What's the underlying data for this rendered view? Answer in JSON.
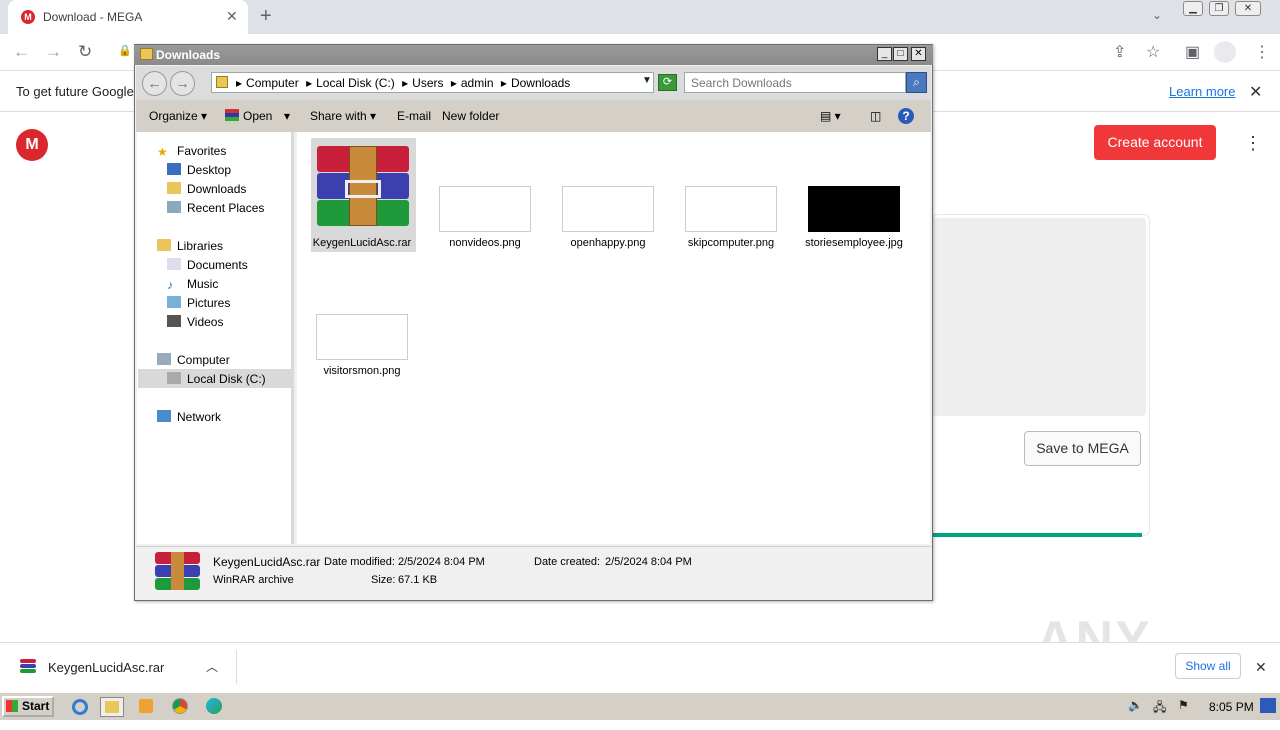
{
  "browser": {
    "tab_title": "Download - MEGA",
    "tab_favicon_letter": "M",
    "new_tab_icon": "+",
    "close_icon": "✕",
    "infobar_text": "To get future Google",
    "learn_more": "Learn more"
  },
  "mega": {
    "logo_letter": "M",
    "create_account": "Create account",
    "save_to_mega": "Save to MEGA",
    "progress_fraction": 1.0
  },
  "explorer": {
    "title": "Downloads",
    "breadcrumbs": [
      "Computer",
      "Local Disk (C:)",
      "Users",
      "admin",
      "Downloads"
    ],
    "search_placeholder": "Search Downloads",
    "commands": {
      "organize": "Organize",
      "open": "Open",
      "share_with": "Share with",
      "email": "E-mail",
      "new_folder": "New folder"
    },
    "nav": {
      "favorites": "Favorites",
      "desktop": "Desktop",
      "downloads": "Downloads",
      "recent_places": "Recent Places",
      "libraries": "Libraries",
      "documents": "Documents",
      "music": "Music",
      "pictures": "Pictures",
      "videos": "Videos",
      "computer": "Computer",
      "local_disk": "Local Disk (C:)",
      "network": "Network"
    },
    "files": [
      {
        "name": "KeygenLucidAsc.rar",
        "type": "rar",
        "selected": true
      },
      {
        "name": "nonvideos.png",
        "type": "png"
      },
      {
        "name": "openhappy.png",
        "type": "png"
      },
      {
        "name": "skipcomputer.png",
        "type": "png"
      },
      {
        "name": "storiesemployee.jpg",
        "type": "jpg-dark"
      },
      {
        "name": "visitorsmon.png",
        "type": "png"
      }
    ],
    "details": {
      "name": "KeygenLucidAsc.rar",
      "kind": "WinRAR archive",
      "date_modified_label": "Date modified:",
      "date_modified": "2/5/2024 8:04 PM",
      "date_created_label": "Date created:",
      "date_created": "2/5/2024 8:04 PM",
      "size_label": "Size:",
      "size": "67.1 KB"
    }
  },
  "download_bar": {
    "file": "KeygenLucidAsc.rar",
    "show_all": "Show all"
  },
  "watermark": "ANY RUN",
  "taskbar": {
    "start": "Start",
    "clock": "8:05 PM"
  }
}
